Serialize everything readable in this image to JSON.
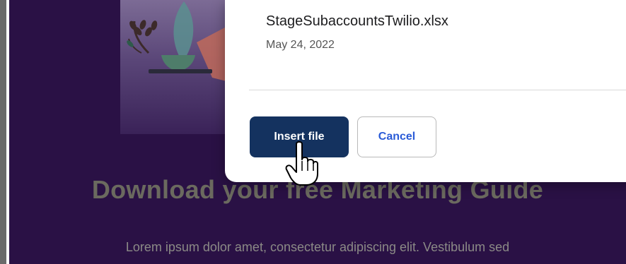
{
  "background_page": {
    "headline": "Download your free Marketing Guide",
    "body_text": "Lorem ipsum dolor amet, consectetur adipiscing elit. Vestibulum sed"
  },
  "file_dialog": {
    "file": {
      "name": "StageSubaccountsTwilio.xlsx",
      "date": "May 24, 2022"
    },
    "buttons": {
      "insert_label": "Insert file",
      "cancel_label": "Cancel"
    }
  },
  "colors": {
    "page_background": "#2a1145",
    "insert_button": "#14325f",
    "cancel_text": "#2a5bd7"
  },
  "icons": {
    "cursor": "hand-pointer-icon",
    "hero": "plant-illustration-icon"
  }
}
